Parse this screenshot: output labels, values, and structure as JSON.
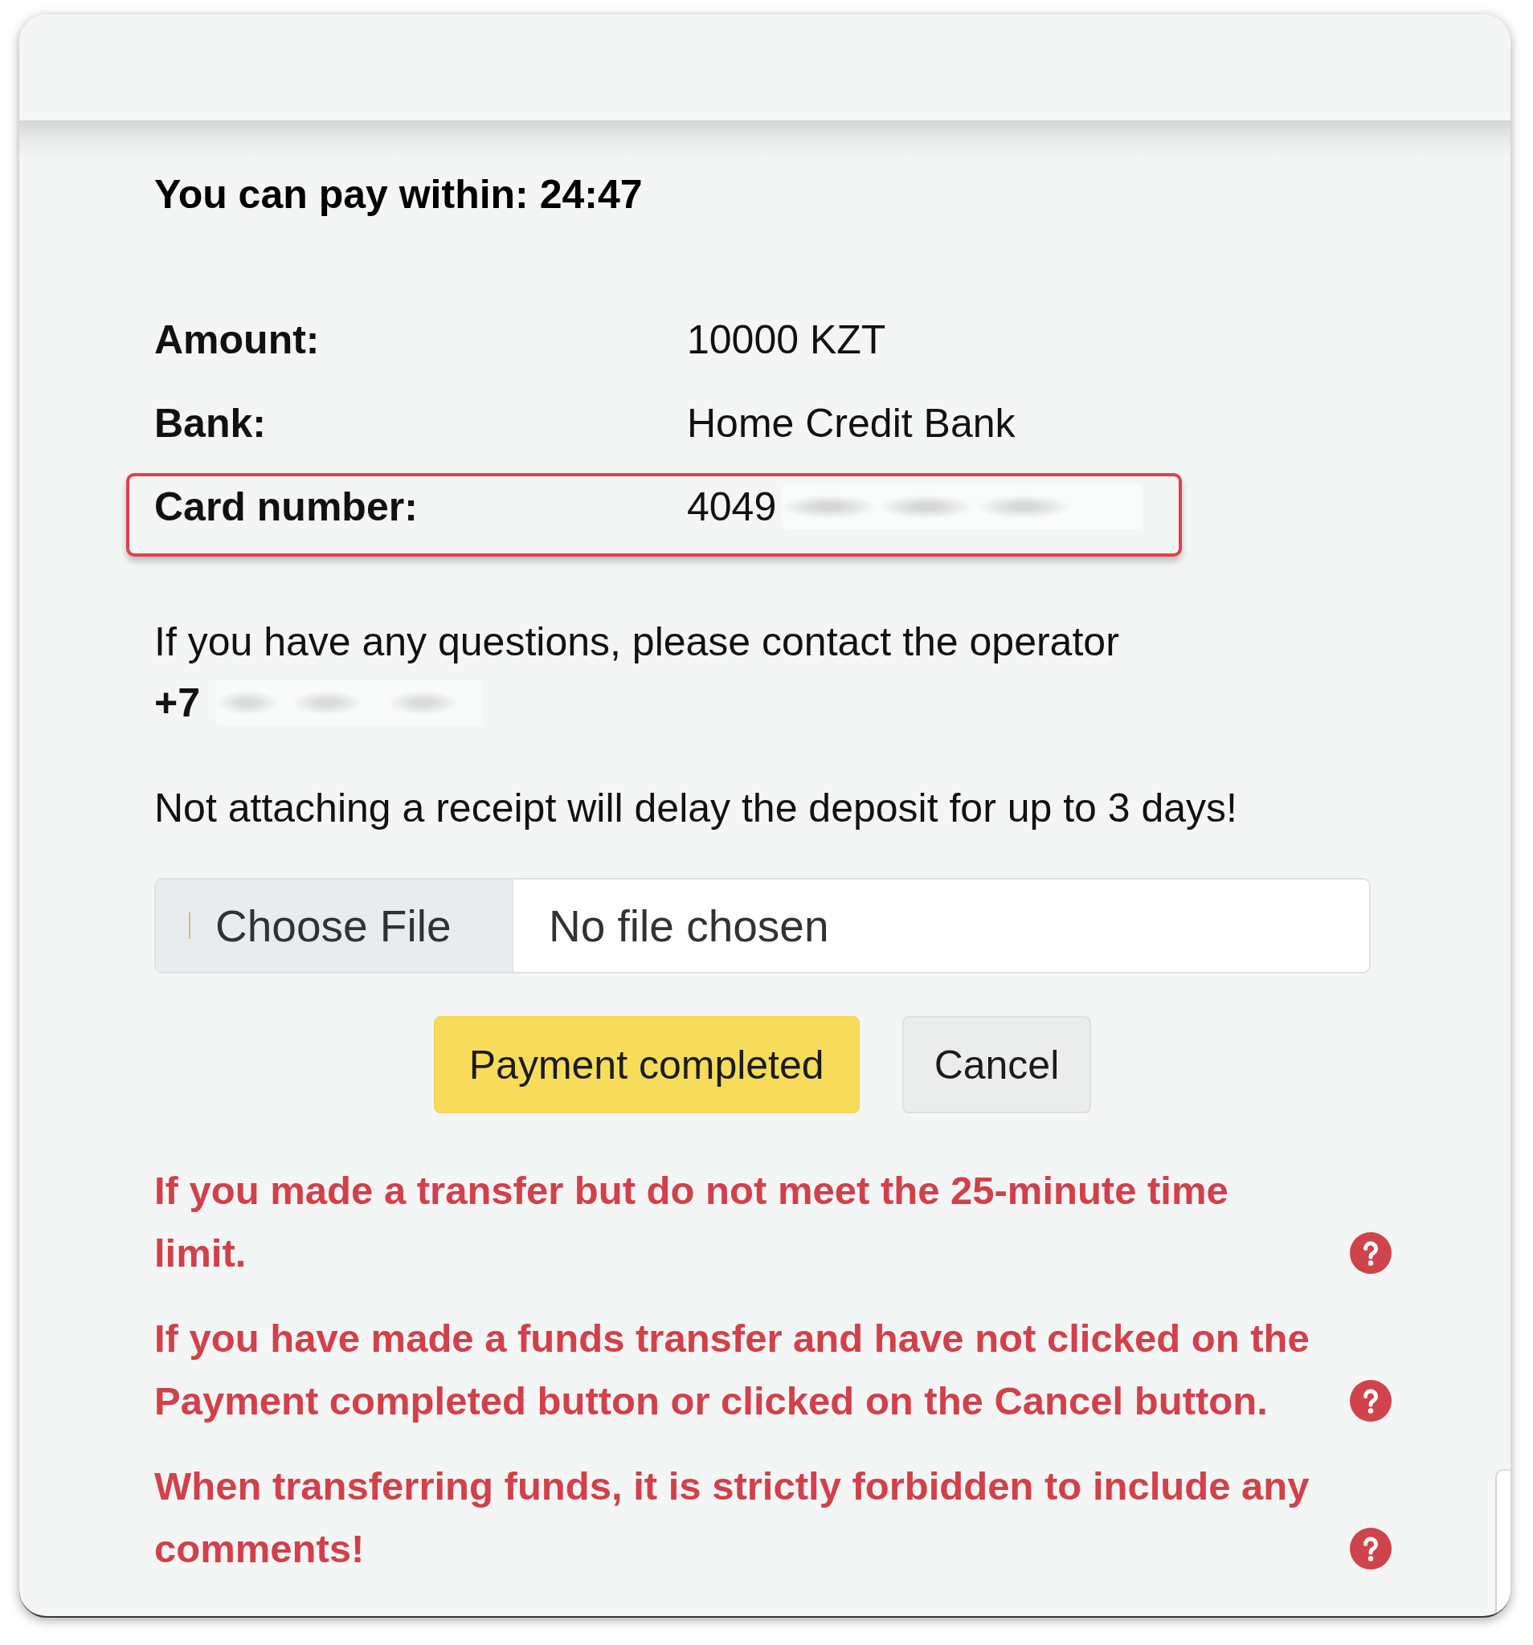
{
  "timer_text": "You can pay within: 24:47",
  "details": [
    {
      "label": "Amount:",
      "value": "10000 KZT",
      "highlighted": false,
      "redacted": false
    },
    {
      "label": "Bank:",
      "value": "Home Credit Bank",
      "highlighted": false,
      "redacted": false
    },
    {
      "label": "Card number:",
      "value": "4049",
      "highlighted": true,
      "redacted": true
    }
  ],
  "contact": {
    "text": "If you have any questions, please contact the operator",
    "phone": "+7",
    "phone_redacted": true
  },
  "notice": "Not attaching a receipt will delay the deposit for up to 3 days!",
  "file_input": {
    "button": "Choose File",
    "status": "No file chosen"
  },
  "buttons": [
    {
      "label": "Payment completed",
      "kind": "primary"
    },
    {
      "label": "Cancel",
      "kind": "secondary"
    }
  ],
  "warnings": [
    {
      "text": "If you made a transfer but do not meet the 25-minute time limit.",
      "help": true
    },
    {
      "text": "If you have made a funds transfer and have not clicked on the Payment completed button or clicked on the Cancel button.",
      "help": true
    },
    {
      "text": "When transferring funds, it is strictly forbidden to include any comments!",
      "help": true
    }
  ]
}
